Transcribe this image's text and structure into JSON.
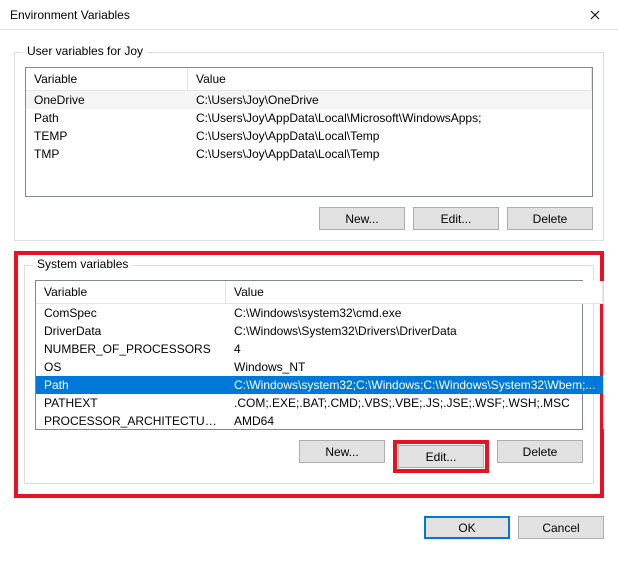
{
  "window": {
    "title": "Environment Variables"
  },
  "userSection": {
    "legend": "User variables for Joy",
    "headers": {
      "variable": "Variable",
      "value": "Value"
    },
    "rows": [
      {
        "variable": "OneDrive",
        "value": "C:\\Users\\Joy\\OneDrive"
      },
      {
        "variable": "Path",
        "value": "C:\\Users\\Joy\\AppData\\Local\\Microsoft\\WindowsApps;"
      },
      {
        "variable": "TEMP",
        "value": "C:\\Users\\Joy\\AppData\\Local\\Temp"
      },
      {
        "variable": "TMP",
        "value": "C:\\Users\\Joy\\AppData\\Local\\Temp"
      }
    ],
    "buttons": {
      "new": "New...",
      "edit": "Edit...",
      "delete": "Delete"
    }
  },
  "systemSection": {
    "legend": "System variables",
    "headers": {
      "variable": "Variable",
      "value": "Value"
    },
    "rows": [
      {
        "variable": "ComSpec",
        "value": "C:\\Windows\\system32\\cmd.exe"
      },
      {
        "variable": "DriverData",
        "value": "C:\\Windows\\System32\\Drivers\\DriverData"
      },
      {
        "variable": "NUMBER_OF_PROCESSORS",
        "value": "4"
      },
      {
        "variable": "OS",
        "value": "Windows_NT"
      },
      {
        "variable": "Path",
        "value": "C:\\Windows\\system32;C:\\Windows;C:\\Windows\\System32\\Wbem;..."
      },
      {
        "variable": "PATHEXT",
        "value": ".COM;.EXE;.BAT;.CMD;.VBS;.VBE;.JS;.JSE;.WSF;.WSH;.MSC"
      },
      {
        "variable": "PROCESSOR_ARCHITECTURE",
        "value": "AMD64"
      }
    ],
    "selectedIndex": 4,
    "buttons": {
      "new": "New...",
      "edit": "Edit...",
      "delete": "Delete"
    }
  },
  "dialogButtons": {
    "ok": "OK",
    "cancel": "Cancel"
  }
}
